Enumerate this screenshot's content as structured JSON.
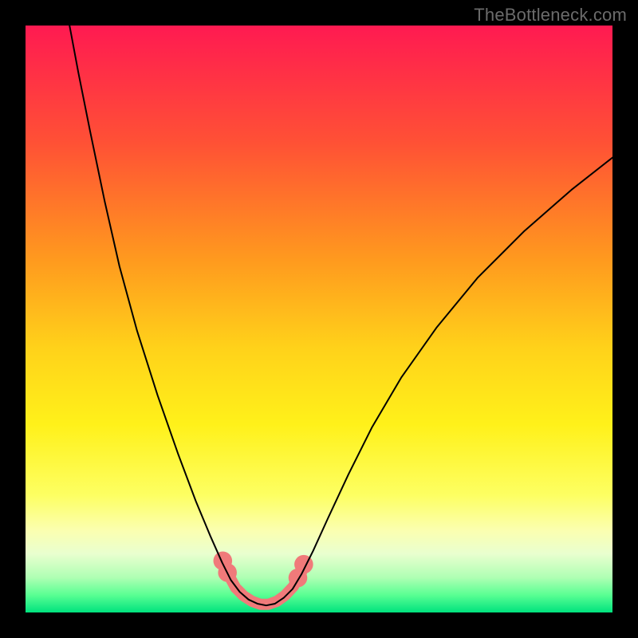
{
  "watermark": "TheBottleneck.com",
  "chart_data": {
    "type": "line",
    "title": "",
    "xlabel": "",
    "ylabel": "",
    "xlim": [
      0,
      100
    ],
    "ylim": [
      0,
      100
    ],
    "grid": false,
    "legend": false,
    "background_gradient": [
      {
        "pos": 0.0,
        "color": "#ff1a51"
      },
      {
        "pos": 0.2,
        "color": "#ff5135"
      },
      {
        "pos": 0.4,
        "color": "#ff9a1e"
      },
      {
        "pos": 0.55,
        "color": "#ffd21a"
      },
      {
        "pos": 0.68,
        "color": "#fff11a"
      },
      {
        "pos": 0.8,
        "color": "#fdff62"
      },
      {
        "pos": 0.86,
        "color": "#fbffb0"
      },
      {
        "pos": 0.9,
        "color": "#e9ffcf"
      },
      {
        "pos": 0.94,
        "color": "#b0ffb4"
      },
      {
        "pos": 0.97,
        "color": "#5aff93"
      },
      {
        "pos": 1.0,
        "color": "#00e27e"
      }
    ],
    "series": [
      {
        "name": "left-limb",
        "stroke": "#000000",
        "stroke_width": 2,
        "points": [
          {
            "x": 7.5,
            "y": 100.0
          },
          {
            "x": 9.0,
            "y": 92.0
          },
          {
            "x": 11.0,
            "y": 82.0
          },
          {
            "x": 13.5,
            "y": 70.0
          },
          {
            "x": 16.0,
            "y": 59.0
          },
          {
            "x": 19.0,
            "y": 48.0
          },
          {
            "x": 22.5,
            "y": 37.0
          },
          {
            "x": 26.0,
            "y": 27.0
          },
          {
            "x": 29.0,
            "y": 19.0
          },
          {
            "x": 31.5,
            "y": 13.0
          },
          {
            "x": 33.5,
            "y": 8.5
          },
          {
            "x": 35.0,
            "y": 5.5
          },
          {
            "x": 36.5,
            "y": 3.5
          },
          {
            "x": 38.0,
            "y": 2.2
          },
          {
            "x": 39.5,
            "y": 1.5
          },
          {
            "x": 41.0,
            "y": 1.2
          },
          {
            "x": 42.5,
            "y": 1.5
          },
          {
            "x": 44.0,
            "y": 2.5
          },
          {
            "x": 45.5,
            "y": 4.0
          },
          {
            "x": 47.0,
            "y": 6.5
          },
          {
            "x": 49.0,
            "y": 10.5
          },
          {
            "x": 51.5,
            "y": 16.0
          },
          {
            "x": 55.0,
            "y": 23.5
          },
          {
            "x": 59.0,
            "y": 31.5
          },
          {
            "x": 64.0,
            "y": 40.0
          },
          {
            "x": 70.0,
            "y": 48.5
          },
          {
            "x": 77.0,
            "y": 57.0
          },
          {
            "x": 85.0,
            "y": 65.0
          },
          {
            "x": 93.0,
            "y": 72.0
          },
          {
            "x": 100.0,
            "y": 77.5
          }
        ]
      }
    ],
    "overlay_path": {
      "name": "valley-highlight",
      "stroke": "#f07a7a",
      "stroke_width": 14,
      "linecap": "round",
      "points": [
        {
          "x": 33.5,
          "y": 9.0
        },
        {
          "x": 34.6,
          "y": 6.4
        },
        {
          "x": 35.8,
          "y": 4.2
        },
        {
          "x": 37.2,
          "y": 2.8
        },
        {
          "x": 38.6,
          "y": 1.9
        },
        {
          "x": 40.0,
          "y": 1.4
        },
        {
          "x": 41.4,
          "y": 1.4
        },
        {
          "x": 42.8,
          "y": 1.9
        },
        {
          "x": 44.2,
          "y": 2.9
        },
        {
          "x": 45.6,
          "y": 4.4
        },
        {
          "x": 46.8,
          "y": 6.4
        },
        {
          "x": 47.8,
          "y": 8.6
        }
      ],
      "knobs": [
        {
          "x": 33.6,
          "y": 8.8
        },
        {
          "x": 34.4,
          "y": 6.8
        },
        {
          "x": 46.4,
          "y": 5.9
        },
        {
          "x": 47.4,
          "y": 8.2
        }
      ],
      "knob_radius": 1.6
    }
  }
}
